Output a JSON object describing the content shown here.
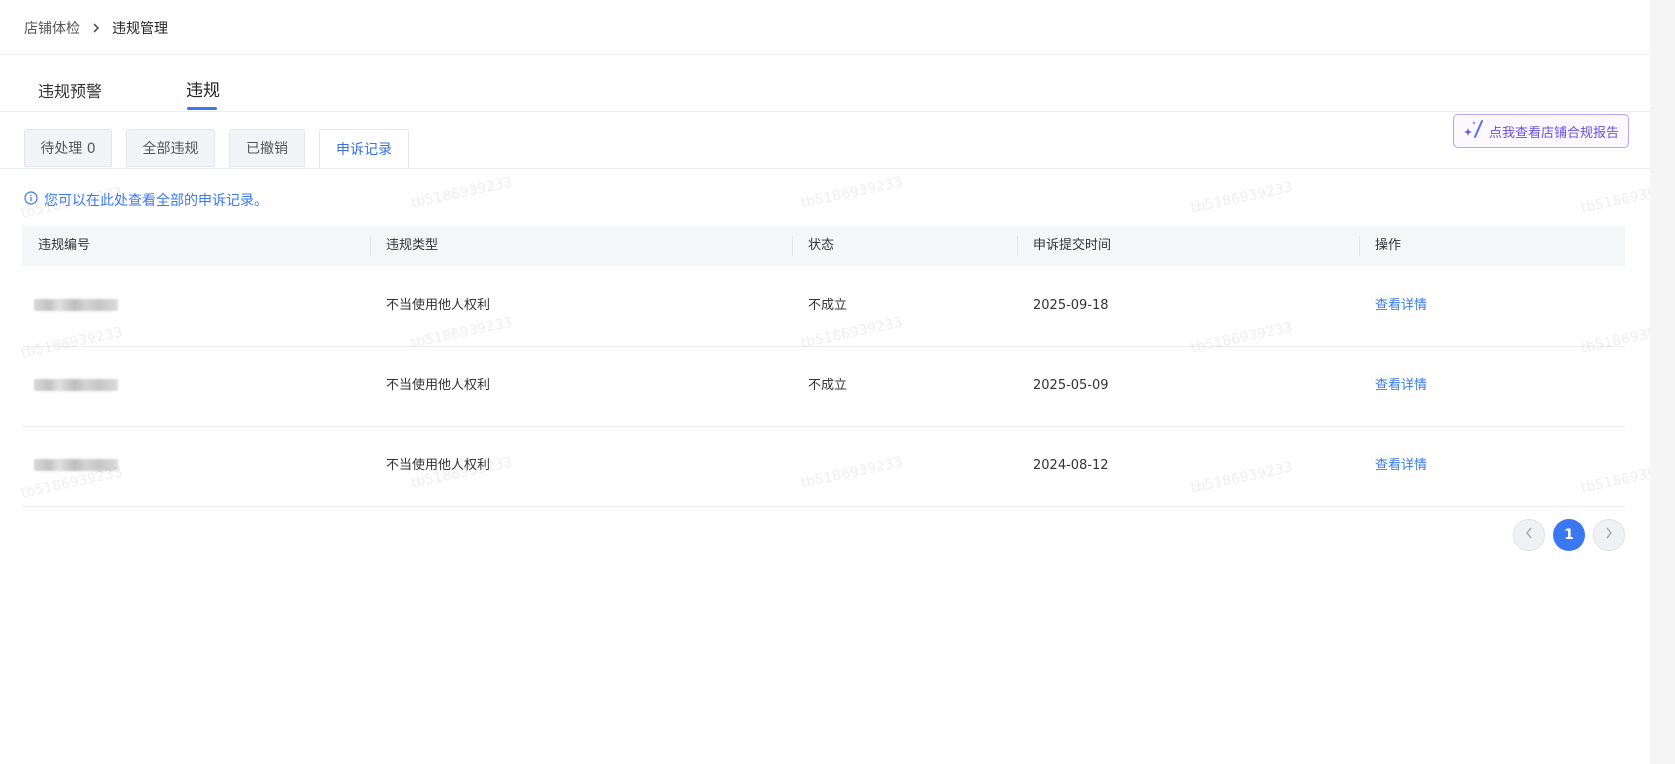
{
  "breadcrumb": {
    "root": "店铺体检",
    "current": "违规管理"
  },
  "main_tabs": [
    {
      "label": "违规预警",
      "active": false
    },
    {
      "label": "违规",
      "active": true
    }
  ],
  "sub_tabs": [
    {
      "label": "待处理 0",
      "active": false
    },
    {
      "label": "全部违规",
      "active": false
    },
    {
      "label": "已撤销",
      "active": false
    },
    {
      "label": "申诉记录",
      "active": true
    }
  ],
  "report_button": {
    "label": "点我查看店铺合规报告",
    "icon": "sparkle-icon"
  },
  "notice": {
    "icon": "info-icon",
    "text": "您可以在此处查看全部的申诉记录。"
  },
  "table": {
    "columns": [
      "违规编号",
      "违规类型",
      "状态",
      "申诉提交时间",
      "操作"
    ],
    "rows": [
      {
        "type": "不当使用他人权利",
        "status": "不成立",
        "submit_time": "2025-09-18",
        "action": "查看详情"
      },
      {
        "type": "不当使用他人权利",
        "status": "不成立",
        "submit_time": "2025-05-09",
        "action": "查看详情"
      },
      {
        "type": "不当使用他人权利",
        "status": "",
        "submit_time": "2024-08-12",
        "action": "查看详情"
      }
    ]
  },
  "pagination": {
    "current_page": "1",
    "prev_icon": "chevron-left-icon",
    "next_icon": "chevron-right-icon"
  },
  "watermark": {
    "text": "tb5186939233"
  },
  "colors": {
    "accent": "#3a78f2",
    "report_accent": "#6a4fe0"
  }
}
